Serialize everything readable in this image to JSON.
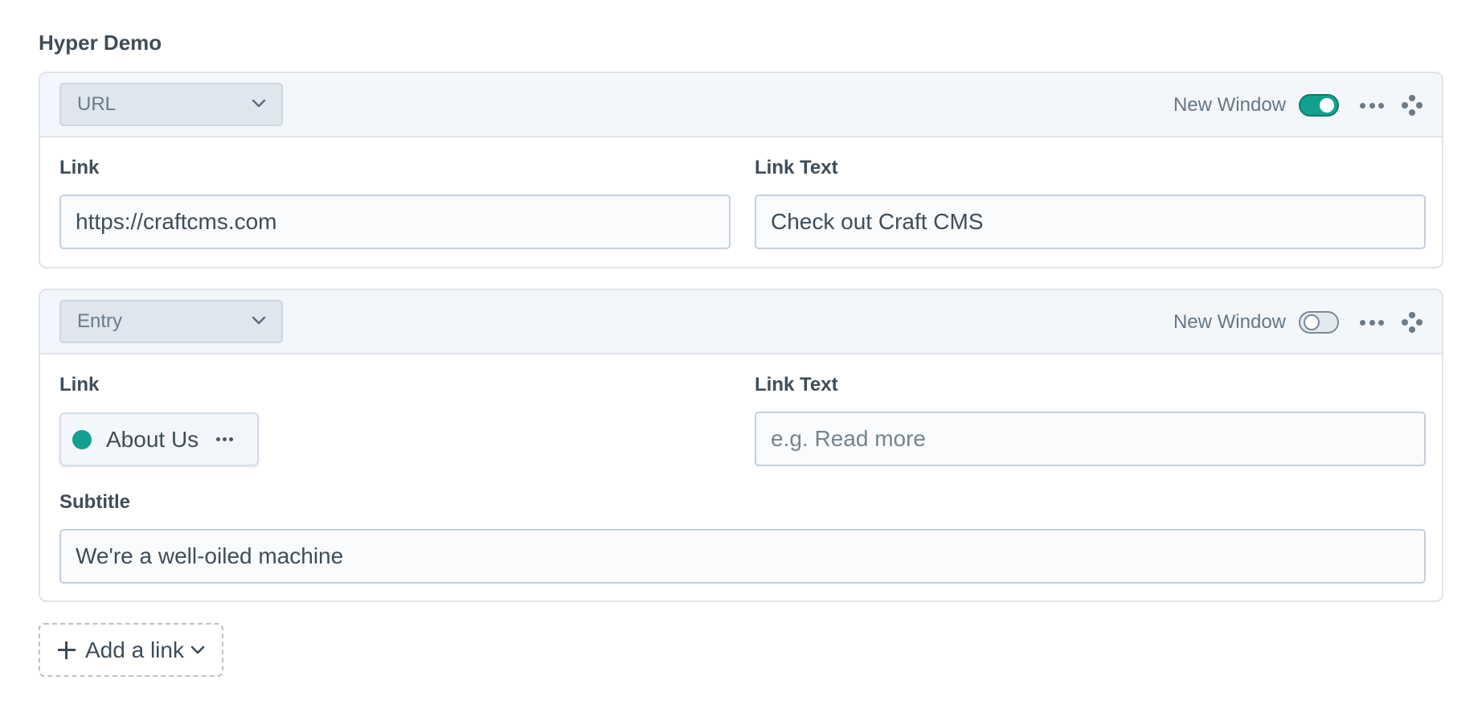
{
  "field": {
    "label": "Hyper Demo"
  },
  "links": [
    {
      "type": "URL",
      "new_window_label": "New Window",
      "new_window": true,
      "link_label": "Link",
      "link_value": "https://craftcms.com",
      "link_text_label": "Link Text",
      "link_text_value": "Check out Craft CMS"
    },
    {
      "type": "Entry",
      "new_window_label": "New Window",
      "new_window": false,
      "link_label": "Link",
      "entry_title": "About Us",
      "entry_status_color": "#14a090",
      "link_text_label": "Link Text",
      "link_text_placeholder": "e.g. Read more",
      "subtitle_label": "Subtitle",
      "subtitle_value": "We're a well-oiled machine"
    }
  ],
  "add_button": {
    "label": "Add a link"
  },
  "icons": {
    "select": "chevron-down-icon",
    "more": "ellipsis-icon",
    "move": "move-icon",
    "add": "plus-icon"
  },
  "colors": {
    "accent": "#14a090",
    "header_bg": "#f3f6fa",
    "border": "#dfe4ea"
  }
}
